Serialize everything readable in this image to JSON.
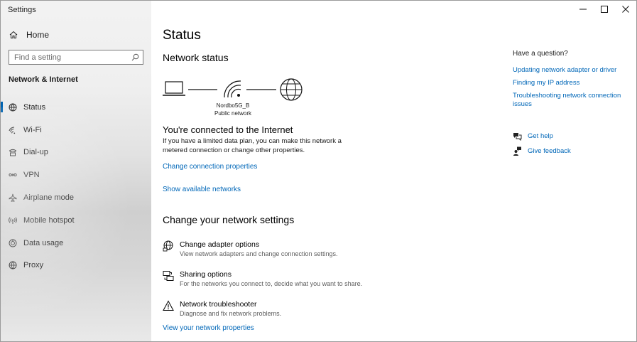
{
  "window": {
    "title": "Settings",
    "controls": {
      "minimize": "—",
      "maximize": "☐",
      "close": "✕"
    }
  },
  "sidebar": {
    "home_label": "Home",
    "search_placeholder": "Find a setting",
    "section_title": "Network & Internet",
    "items": [
      {
        "label": "Status",
        "icon": "status-globe-icon",
        "active": true
      },
      {
        "label": "Wi-Fi",
        "icon": "wifi-icon",
        "active": false
      },
      {
        "label": "Dial-up",
        "icon": "dialup-icon",
        "active": false
      },
      {
        "label": "VPN",
        "icon": "vpn-icon",
        "active": false
      },
      {
        "label": "Airplane mode",
        "icon": "airplane-icon",
        "active": false
      },
      {
        "label": "Mobile hotspot",
        "icon": "hotspot-icon",
        "active": false
      },
      {
        "label": "Data usage",
        "icon": "data-usage-icon",
        "active": false
      },
      {
        "label": "Proxy",
        "icon": "globe-icon",
        "active": false
      }
    ]
  },
  "main": {
    "title": "Status",
    "network_status_heading": "Network status",
    "network": {
      "name": "Nordbo5G_B",
      "type": "Public network"
    },
    "connected_title": "You're connected to the Internet",
    "connected_text": "If you have a limited data plan, you can make this network a metered connection or change other properties.",
    "change_properties_link": "Change connection properties",
    "show_networks_link": "Show available networks",
    "change_settings_heading": "Change your network settings",
    "options": [
      {
        "title": "Change adapter options",
        "desc": "View network adapters and change connection settings.",
        "icon": "adapter-globe-icon"
      },
      {
        "title": "Sharing options",
        "desc": "For the networks you connect to, decide what you want to share.",
        "icon": "sharing-icon"
      },
      {
        "title": "Network troubleshooter",
        "desc": "Diagnose and fix network problems.",
        "icon": "warning-icon"
      }
    ],
    "view_properties_link": "View your network properties"
  },
  "help": {
    "heading": "Have a question?",
    "links": [
      "Updating network adapter or driver",
      "Finding my IP address",
      "Troubleshooting network connection issues"
    ],
    "get_help": "Get help",
    "give_feedback": "Give feedback"
  },
  "colors": {
    "accent": "#0067b8",
    "active_indicator": "#0063b1"
  }
}
